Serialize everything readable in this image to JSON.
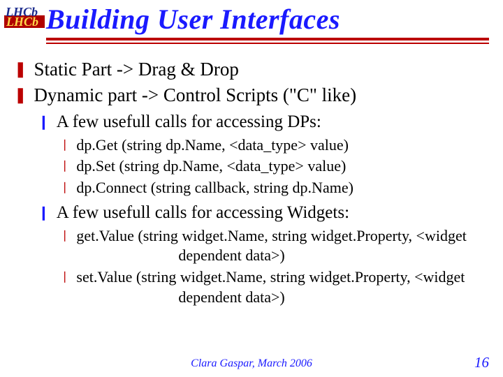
{
  "logo_text": "LHCb",
  "title": "Building User Interfaces",
  "bullets": {
    "b1": "Static Part -> Drag & Drop",
    "b2": "Dynamic part -> Control Scripts (\"C\" like)",
    "b2a": "A few usefull calls for accessing DPs:",
    "b2a1": "dp.Get (string dp.Name, <data_type> value)",
    "b2a2": "dp.Set (string dp.Name, <data_type> value)",
    "b2a3": "dp.Connect (string callback, string dp.Name)",
    "b2b": "A few usefull calls for accessing Widgets:",
    "b2b1": "get.Value (string widget.Name, string widget.Property, <widget dependent data>)",
    "b2b2": "set.Value (string widget.Name, string widget.Property, <widget dependent data>)"
  },
  "footer": "Clara Gaspar, March 2006",
  "page": "16"
}
